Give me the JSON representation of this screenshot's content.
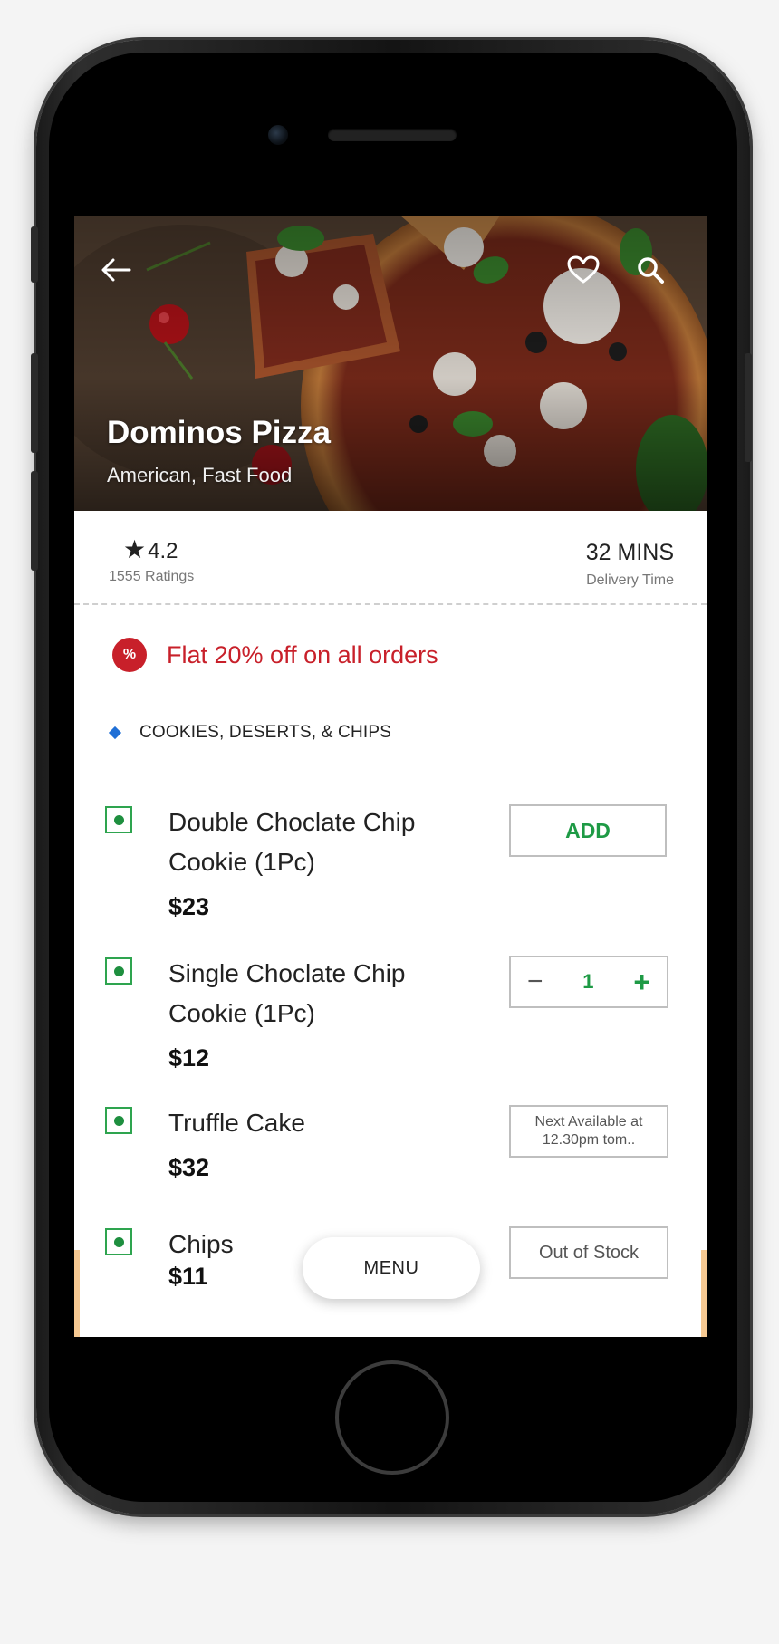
{
  "restaurant": {
    "name": "Dominos Pizza",
    "cuisine": "American, Fast Food"
  },
  "header_icons": [
    "back-arrow-icon",
    "heart-icon",
    "search-icon"
  ],
  "stats": {
    "rating": "4.2",
    "rating_count": "1555 Ratings",
    "delivery_time": "32 MINS",
    "delivery_label": "Delivery Time"
  },
  "offer": {
    "badge": "%",
    "text": "Flat 20% off on all orders"
  },
  "category": {
    "label": "COOKIES, DESERTS, & CHIPS"
  },
  "items": [
    {
      "name": "Double Choclate Chip Cookie (1Pc)",
      "price": "$23",
      "action": "ADD"
    },
    {
      "name": "Single Choclate Chip Cookie (1Pc)",
      "price": "$12",
      "quantity": "1",
      "minus": "−",
      "plus": "+"
    },
    {
      "name": "Truffle Cake",
      "price": "$32",
      "status": "Next Available at 12.30pm tom.."
    },
    {
      "name": "Chips",
      "price": "$11",
      "status": "Out of Stock"
    }
  ],
  "menu_button": "MENU",
  "colors": {
    "accent_red": "#c8202a",
    "veg_green": "#1e9a45",
    "category_blue": "#1f6fd6"
  }
}
